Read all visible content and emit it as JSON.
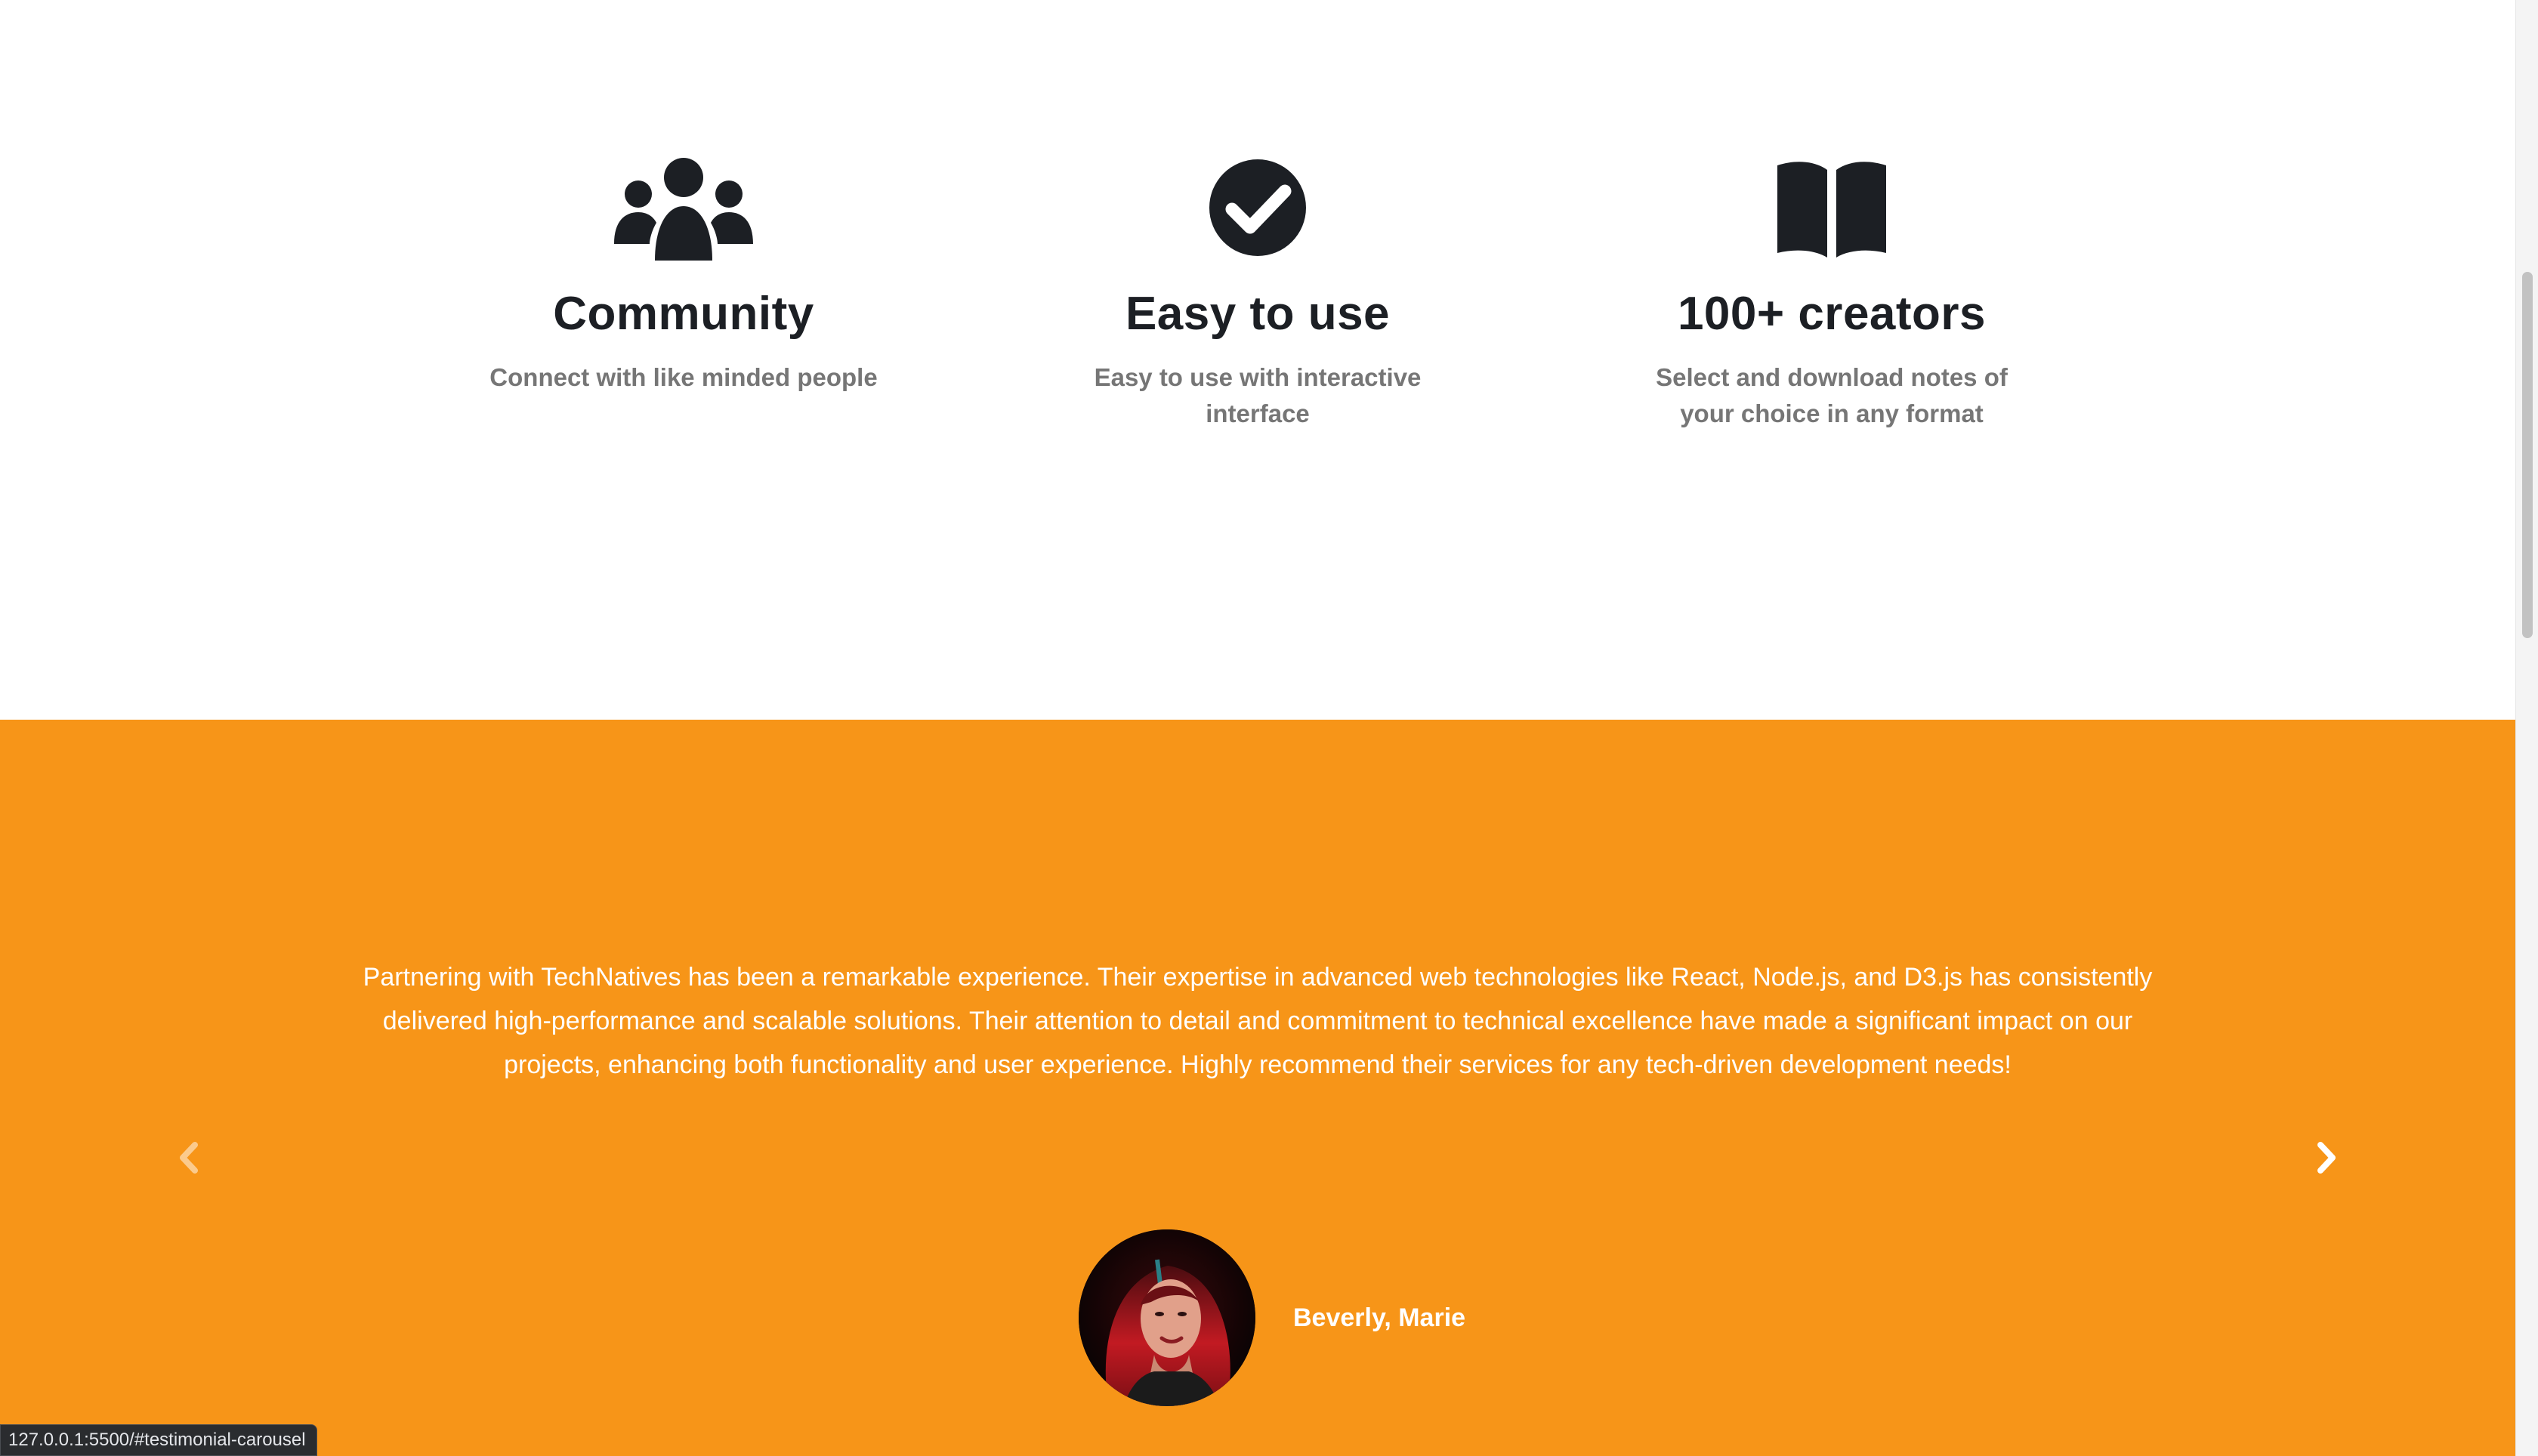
{
  "features": [
    {
      "icon": "users-icon",
      "title": "Community",
      "description": "Connect with like minded people"
    },
    {
      "icon": "check-circle-icon",
      "title": "Easy to use",
      "description": "Easy to use with interactive interface"
    },
    {
      "icon": "book-open-icon",
      "title": "100+ creators",
      "description": "Select and download notes of your choice in any format"
    }
  ],
  "testimonial": {
    "quote": "Partnering with TechNatives has been a remarkable experience. Their expertise in advanced web technologies like React, Node.js, and D3.js has consistently delivered high-performance and scalable solutions. Their attention to detail and commitment to technical excellence have made a significant impact on our projects, enhancing both functionality and user experience. Highly recommend their services for any tech-driven development needs!",
    "author_name": "Beverly, Marie",
    "prev_icon": "chevron-left-icon",
    "next_icon": "chevron-right-icon"
  },
  "status_bar": {
    "url": "127.0.0.1:5500/#testimonial-carousel"
  },
  "colors": {
    "accent": "#f79518",
    "heading": "#1c1f24",
    "muted": "#767676"
  }
}
